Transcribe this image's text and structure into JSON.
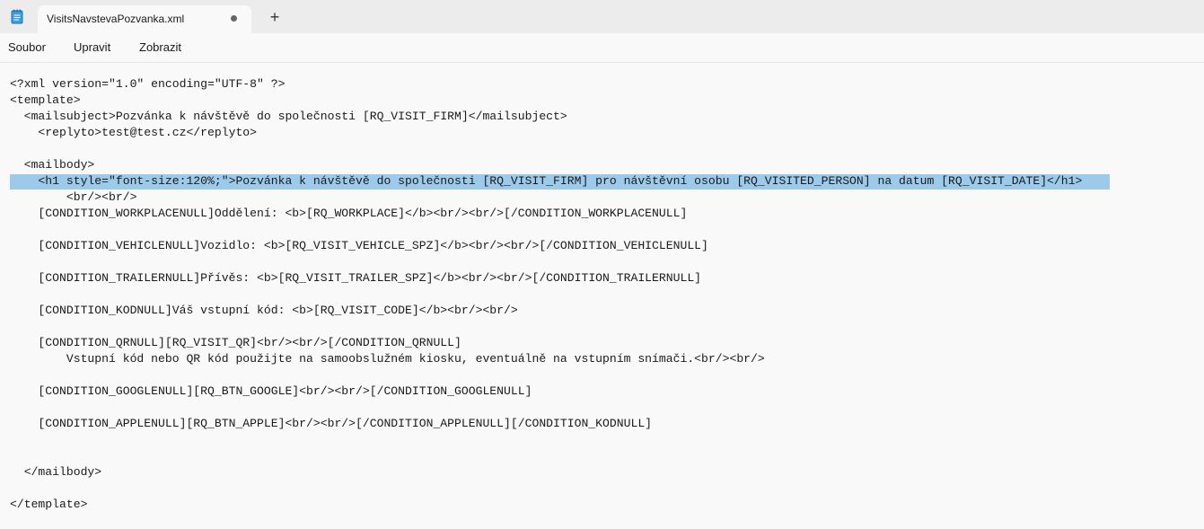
{
  "window": {
    "app_icon": "notepad-icon",
    "tab_title": "VisitsNavstevaPozvanka.xml",
    "tab_modified_indicator": "unsaved-dot-icon",
    "new_tab_icon": "plus-icon",
    "new_tab_glyph": "+"
  },
  "menu": {
    "file": "Soubor",
    "edit": "Upravit",
    "view": "Zobrazit"
  },
  "editor": {
    "selection_color": "#9ccaeb",
    "lines": [
      "<?xml version=\"1.0\" encoding=\"UTF-8\" ?>",
      "<template>",
      "  <mailsubject>Pozvánka k návštěvě do společnosti [RQ_VISIT_FIRM]</mailsubject>",
      "    <replyto>test@test.cz</replyto>",
      "",
      "  <mailbody>",
      "    <h1 style=\"font-size:120%;\">Pozvánka k návštěvě do společnosti [RQ_VISIT_FIRM] pro návštěvní osobu [RQ_VISITED_PERSON] na datum [RQ_VISIT_DATE]</h1>",
      "        <br/><br/>",
      "    [CONDITION_WORKPLACENULL]Oddělení: <b>[RQ_WORKPLACE]</b><br/><br/>[/CONDITION_WORKPLACENULL]",
      "",
      "    [CONDITION_VEHICLENULL]Vozidlo: <b>[RQ_VISIT_VEHICLE_SPZ]</b><br/><br/>[/CONDITION_VEHICLENULL]",
      "",
      "    [CONDITION_TRAILERNULL]Přívěs: <b>[RQ_VISIT_TRAILER_SPZ]</b><br/><br/>[/CONDITION_TRAILERNULL]",
      "",
      "    [CONDITION_KODNULL]Váš vstupní kód: <b>[RQ_VISIT_CODE]</b><br/><br/>",
      "",
      "    [CONDITION_QRNULL][RQ_VISIT_QR]<br/><br/>[/CONDITION_QRNULL]",
      "        Vstupní kód nebo QR kód použijte na samoobslužném kiosku, eventuálně na vstupním snímači.<br/><br/>",
      "",
      "    [CONDITION_GOOGLENULL][RQ_BTN_GOOGLE]<br/><br/>[/CONDITION_GOOGLENULL]",
      "",
      "    [CONDITION_APPLENULL][RQ_BTN_APPLE]<br/><br/>[/CONDITION_APPLENULL][/CONDITION_KODNULL]",
      "",
      "",
      "  </mailbody>",
      "",
      "</template>"
    ]
  }
}
